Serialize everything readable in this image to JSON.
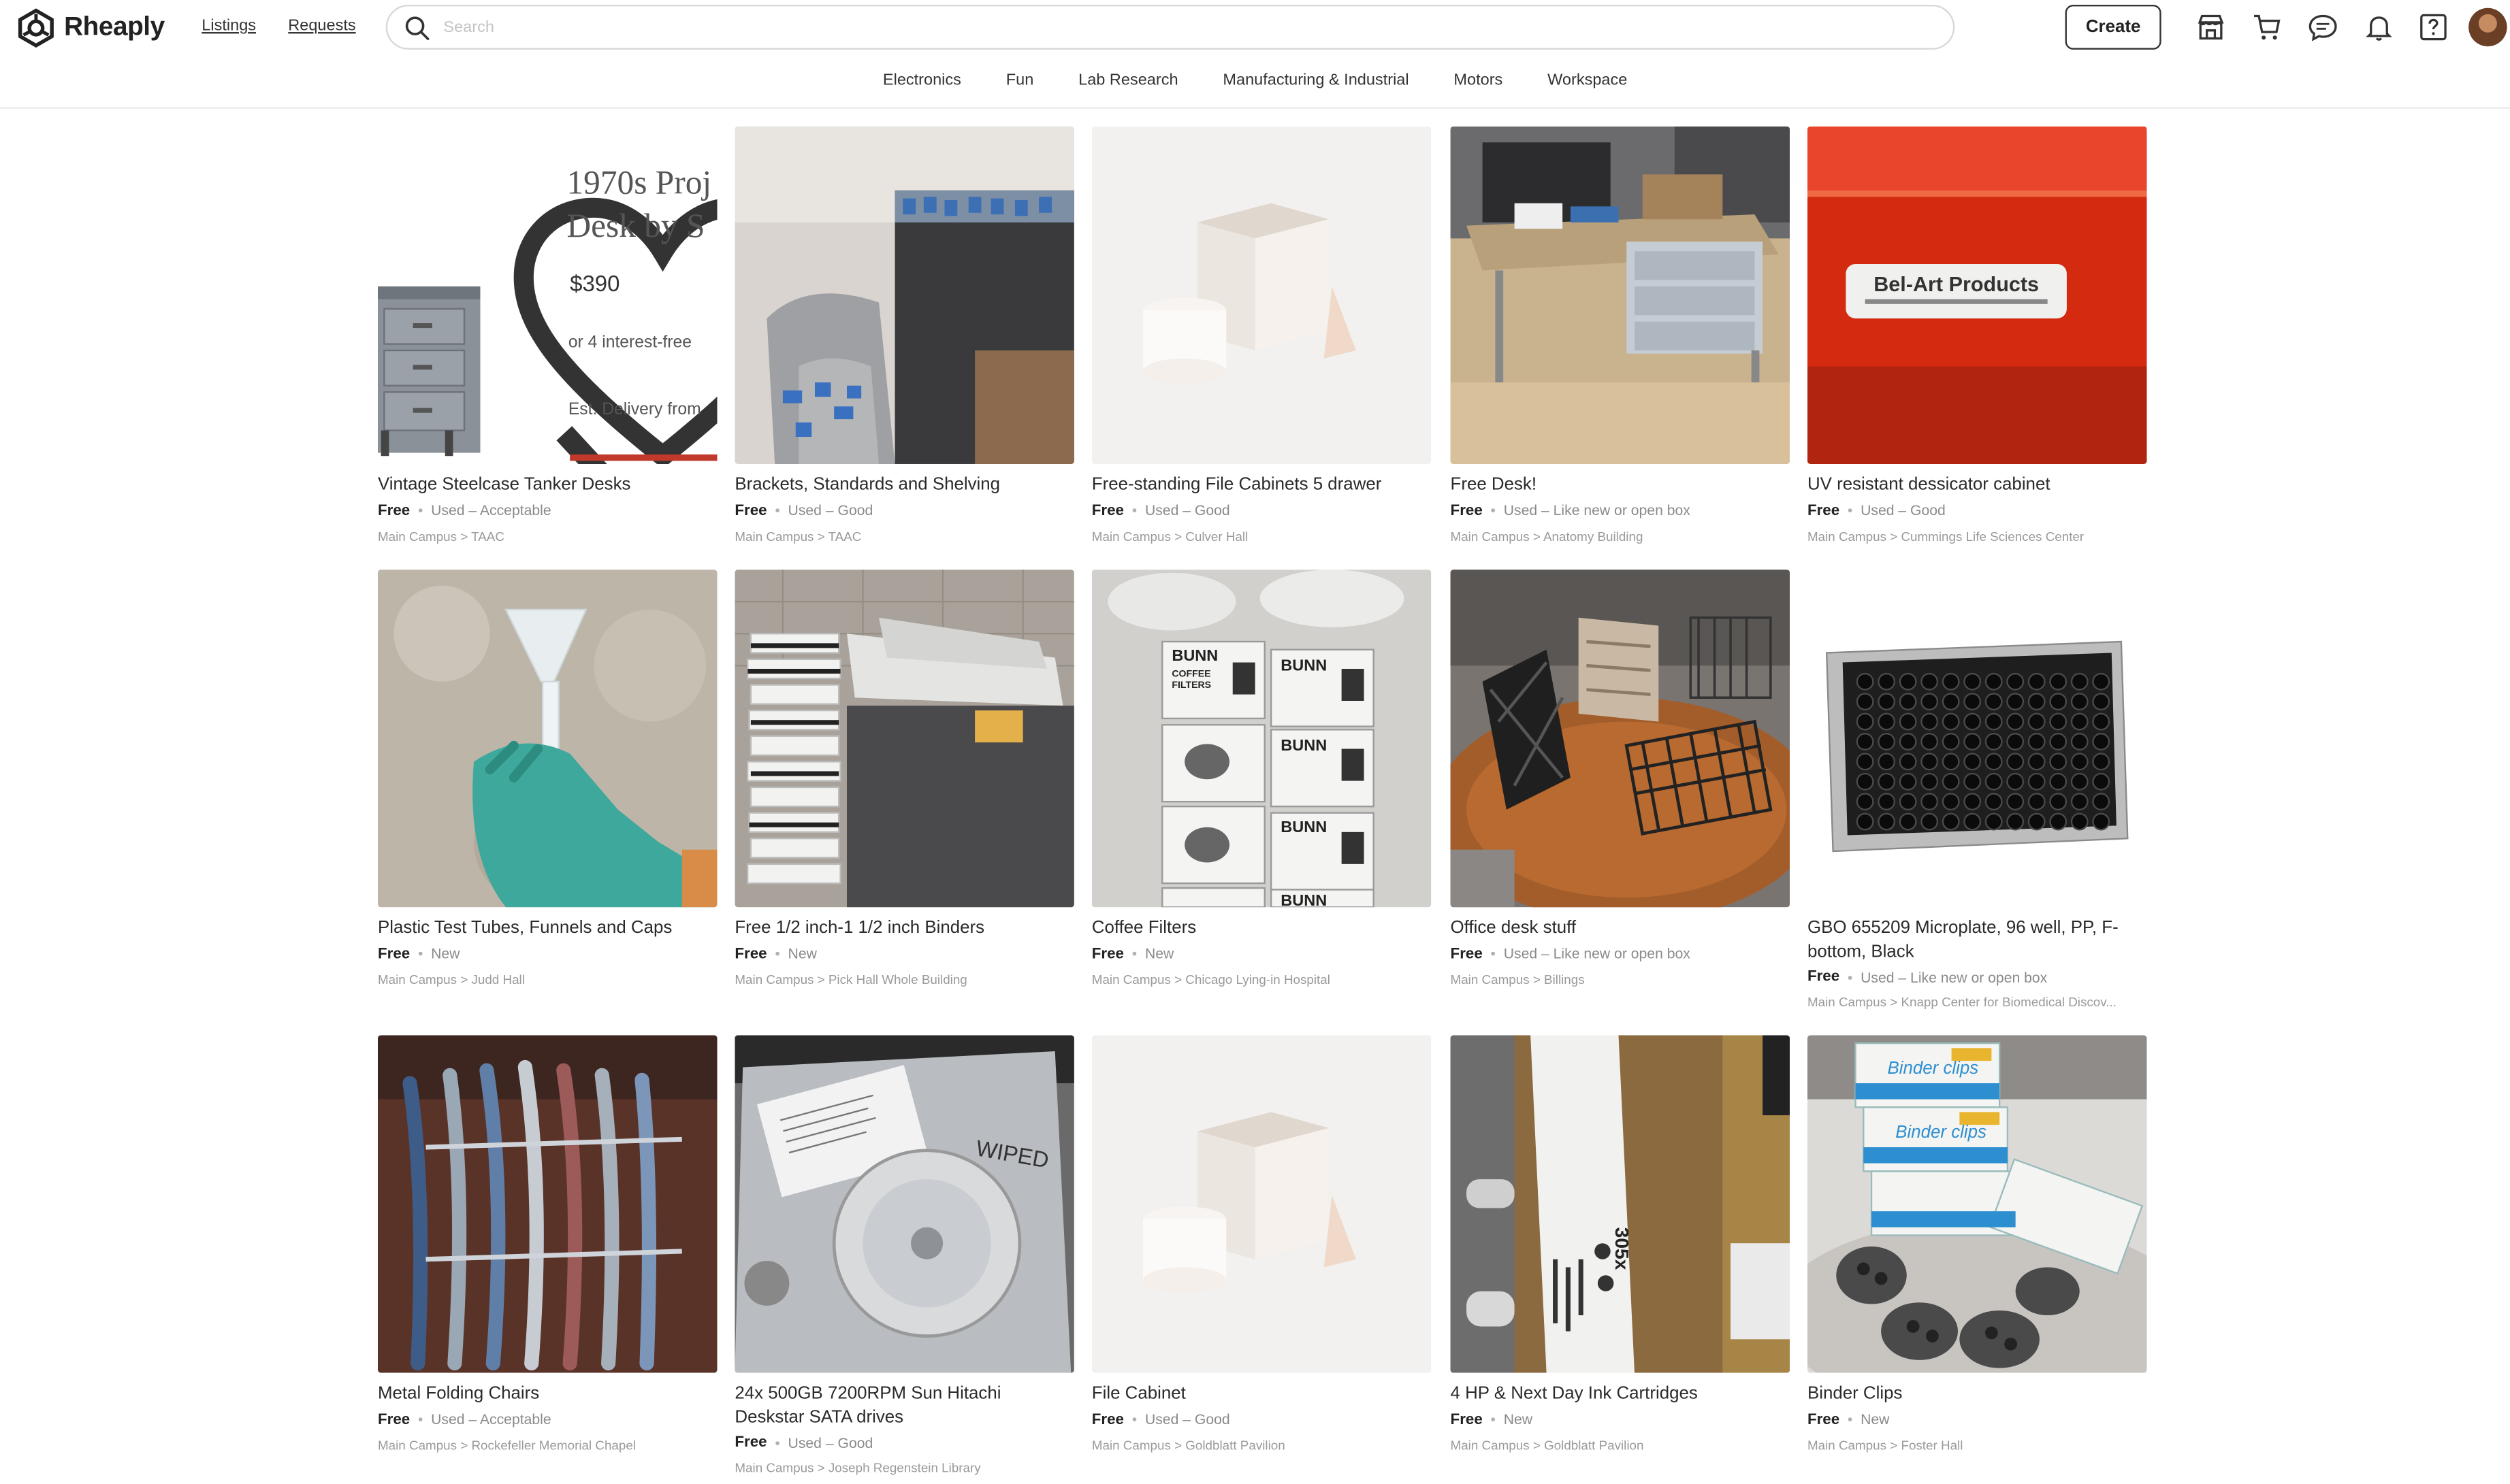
{
  "header": {
    "brand": "Rheaply",
    "nav": [
      "Listings",
      "Requests"
    ],
    "search_placeholder": "Search",
    "create_label": "Create",
    "icons": [
      "storefront-icon",
      "cart-icon",
      "chat-icon",
      "bell-icon",
      "help-icon",
      "avatar"
    ]
  },
  "categories": [
    "Electronics",
    "Fun",
    "Lab Research",
    "Manufacturing & Industrial",
    "Motors",
    "Workspace"
  ],
  "ad_banner": {
    "title_line1": "1970s Proj",
    "title_line2": "Desk by S",
    "price": "$390",
    "financing": "or 4 interest-free",
    "delivery": "Est. Delivery from"
  },
  "listings": [
    {
      "title": "Vintage Steelcase Tanker Desks",
      "price": "Free",
      "condition": "Used – Acceptable",
      "location": "Main Campus > TAAC"
    },
    {
      "title": "Brackets, Standards and Shelving",
      "price": "Free",
      "condition": "Used – Good",
      "location": "Main Campus > TAAC"
    },
    {
      "title": "Free-standing File Cabinets 5 drawer",
      "price": "Free",
      "condition": "Used – Good",
      "location": "Main Campus > Culver Hall"
    },
    {
      "title": "Free Desk!",
      "price": "Free",
      "condition": "Used – Like new or open box",
      "location": "Main Campus > Anatomy Building"
    },
    {
      "title": "UV resistant dessicator cabinet",
      "price": "Free",
      "condition": "Used – Good",
      "location": "Main Campus > Cummings Life Sciences Center"
    },
    {
      "title": "Plastic Test Tubes, Funnels and Caps",
      "price": "Free",
      "condition": "New",
      "location": "Main Campus > Judd Hall"
    },
    {
      "title": "Free 1/2 inch-1 1/2 inch Binders",
      "price": "Free",
      "condition": "New",
      "location": "Main Campus > Pick Hall Whole Building"
    },
    {
      "title": "Coffee Filters",
      "price": "Free",
      "condition": "New",
      "location": "Main Campus > Chicago Lying-in Hospital"
    },
    {
      "title": "Office desk stuff",
      "price": "Free",
      "condition": "Used – Like new or open box",
      "location": "Main Campus > Billings"
    },
    {
      "title": "GBO 655209 Microplate, 96 well, PP, F-bottom, Black",
      "price": "Free",
      "condition": "Used – Like new or open box",
      "location": "Main Campus > Knapp Center for Biomedical Discov..."
    },
    {
      "title": "Metal Folding Chairs",
      "price": "Free",
      "condition": "Used – Acceptable",
      "location": "Main Campus > Rockefeller Memorial Chapel"
    },
    {
      "title": "24x 500GB 7200RPM Sun Hitachi Deskstar SATA drives",
      "price": "Free",
      "condition": "Used – Good",
      "location": "Main Campus > Joseph Regenstein Library"
    },
    {
      "title": "File Cabinet",
      "price": "Free",
      "condition": "Used – Good",
      "location": "Main Campus > Goldblatt Pavilion"
    },
    {
      "title": "4 HP & Next Day Ink Cartridges",
      "price": "Free",
      "condition": "New",
      "location": "Main Campus > Goldblatt Pavilion"
    },
    {
      "title": "Binder Clips",
      "price": "Free",
      "condition": "New",
      "location": "Main Campus > Foster Hall"
    }
  ],
  "image_text": {
    "belart": "Bel-Art Products",
    "bunn": "BUNN",
    "coffee": "COFFEE",
    "filters": "FILTERS",
    "wiped": "WIPED",
    "cartridge": "305x",
    "binderclips": "Binder clips"
  },
  "colors": {
    "accent_red": "#c0392b",
    "text": "#222222",
    "muted": "#8a8a8a"
  }
}
